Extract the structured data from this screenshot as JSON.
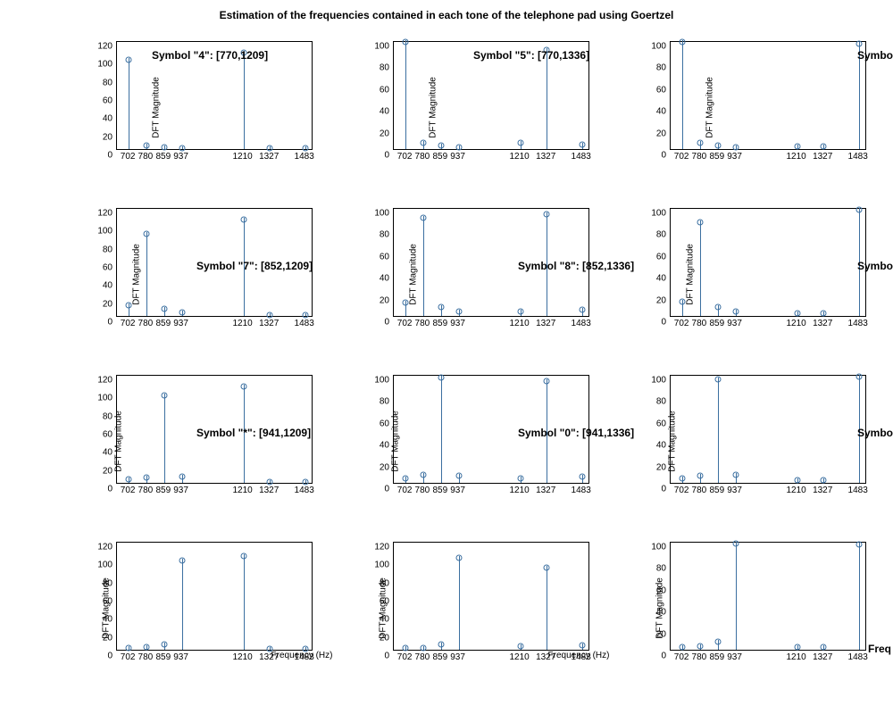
{
  "chart_data": {
    "title": "Estimation of the frequencies contained in each tone of the telephone pad using Goertzel",
    "type": "bar",
    "x_categories": [
      702,
      780,
      859,
      937,
      1210,
      1327,
      1483
    ],
    "x_range": [
      650,
      1520
    ],
    "ylabel": "DFT Magnitude",
    "xlabel": "Frequency (Hz)",
    "overlay_labels": [
      {
        "text": "Symbol \"4\": [770,1209]",
        "left": 170,
        "top": 55
      },
      {
        "text": "Symbol \"5\": [770,1336]",
        "left": 530,
        "top": 55
      },
      {
        "text": "Symbol",
        "left": 960,
        "top": 55
      },
      {
        "text": "Symbol \"7\": [852,1209]",
        "left": 220,
        "top": 291
      },
      {
        "text": "Symbol \"8\": [852,1336]",
        "left": 580,
        "top": 291
      },
      {
        "text": "Symbol",
        "left": 960,
        "top": 291
      },
      {
        "text": "Symbol \"*\": [941,1209]",
        "left": 220,
        "top": 478
      },
      {
        "text": "Symbol \"0\": [941,1336]",
        "left": 580,
        "top": 478
      },
      {
        "text": "Symbol",
        "left": 960,
        "top": 478
      },
      {
        "text": "Freq",
        "left": 972,
        "top": 720
      }
    ],
    "grid": [
      {
        "left": 100,
        "top": 40
      },
      {
        "left": 410,
        "top": 40
      },
      {
        "left": 720,
        "top": 40
      },
      {
        "left": 100,
        "top": 227
      },
      {
        "left": 410,
        "top": 227
      },
      {
        "left": 720,
        "top": 227
      },
      {
        "left": 100,
        "top": 414
      },
      {
        "left": 410,
        "top": 414
      },
      {
        "left": 720,
        "top": 414
      },
      {
        "left": 100,
        "top": 601
      },
      {
        "left": 410,
        "top": 601
      },
      {
        "left": 720,
        "top": 601
      }
    ],
    "subplots": [
      {
        "ymax": 120,
        "ystep": 20,
        "values": [
          100,
          6,
          4,
          3,
          108,
          3,
          3
        ],
        "show_ylabel": true,
        "show_xlabel": false,
        "ylabel_x": 110,
        "xlabel_x": 0
      },
      {
        "ymax": 100,
        "ystep": 20,
        "values": [
          100,
          7,
          5,
          3,
          7,
          93,
          6
        ],
        "show_ylabel": true,
        "show_xlabel": false,
        "ylabel_x": 110,
        "xlabel_x": 0
      },
      {
        "ymax": 100,
        "ystep": 20,
        "values": [
          100,
          7,
          5,
          3,
          4,
          4,
          98
        ],
        "show_ylabel": true,
        "show_xlabel": false,
        "ylabel_x": 110,
        "xlabel_x": 0
      },
      {
        "ymax": 120,
        "ystep": 20,
        "values": [
          14,
          92,
          10,
          6,
          108,
          3,
          3
        ],
        "show_ylabel": true,
        "show_xlabel": false,
        "ylabel_x": 88,
        "xlabel_x": 0
      },
      {
        "ymax": 100,
        "ystep": 20,
        "values": [
          14,
          92,
          10,
          6,
          6,
          95,
          7
        ],
        "show_ylabel": true,
        "show_xlabel": false,
        "ylabel_x": 88,
        "xlabel_x": 0
      },
      {
        "ymax": 100,
        "ystep": 20,
        "values": [
          15,
          88,
          10,
          6,
          4,
          4,
          99
        ],
        "show_ylabel": true,
        "show_xlabel": false,
        "ylabel_x": 88,
        "xlabel_x": 0
      },
      {
        "ymax": 120,
        "ystep": 20,
        "values": [
          6,
          8,
          98,
          9,
          108,
          3,
          3
        ],
        "show_ylabel": true,
        "show_xlabel": false,
        "ylabel_x": 68,
        "xlabel_x": 0
      },
      {
        "ymax": 100,
        "ystep": 20,
        "values": [
          6,
          9,
          98,
          8,
          6,
          95,
          7
        ],
        "show_ylabel": true,
        "show_xlabel": false,
        "ylabel_x": 68,
        "xlabel_x": 0
      },
      {
        "ymax": 100,
        "ystep": 20,
        "values": [
          6,
          8,
          97,
          9,
          4,
          4,
          99
        ],
        "show_ylabel": true,
        "show_xlabel": false,
        "ylabel_x": 68,
        "xlabel_x": 0
      },
      {
        "ymax": 120,
        "ystep": 20,
        "values": [
          4,
          5,
          8,
          100,
          105,
          3,
          3
        ],
        "show_ylabel": true,
        "show_xlabel": true,
        "ylabel_x": 54,
        "xlabel_x": 98
      },
      {
        "ymax": 120,
        "ystep": 20,
        "values": [
          4,
          4,
          8,
          103,
          6,
          92,
          7
        ],
        "show_ylabel": true,
        "show_xlabel": true,
        "ylabel_x": 54,
        "xlabel_x": 98
      },
      {
        "ymax": 100,
        "ystep": 20,
        "values": [
          4,
          5,
          9,
          99,
          4,
          4,
          98
        ],
        "show_ylabel": true,
        "show_xlabel": false,
        "ylabel_x": 54,
        "xlabel_x": 0
      }
    ]
  }
}
